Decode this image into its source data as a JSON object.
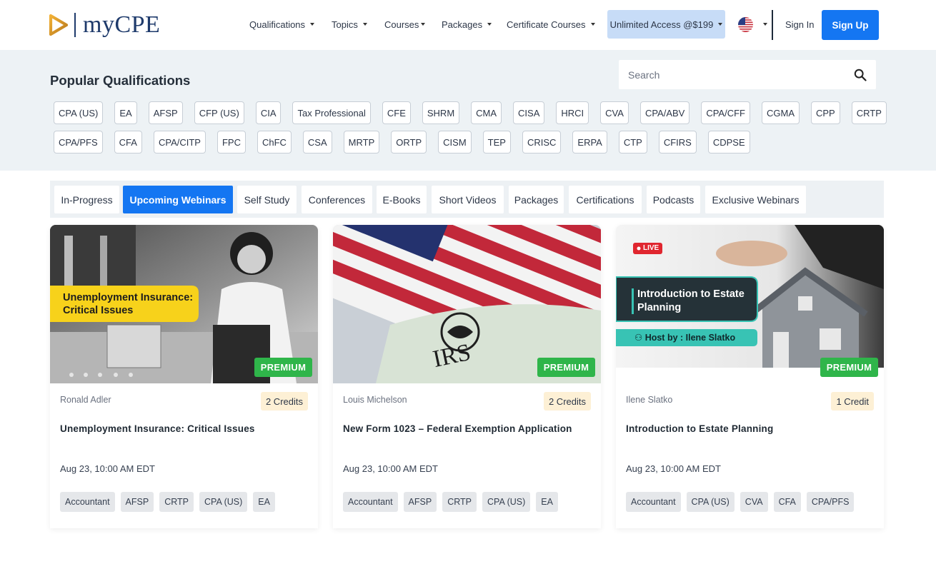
{
  "brand": {
    "name": "myCPE",
    "accent": "#1476f2",
    "navy": "#1e3a6b",
    "gold": "#d99a2b"
  },
  "nav": {
    "items": [
      {
        "label": "Qualifications"
      },
      {
        "label": "Topics"
      },
      {
        "label": "Courses"
      },
      {
        "label": "Packages"
      },
      {
        "label": "Certificate Courses"
      }
    ],
    "unlimited": "Unlimited Access @$199",
    "flag_icon": "us-flag-icon",
    "sign_in": "Sign In",
    "sign_up": "Sign Up"
  },
  "qualifications": {
    "title": "Popular Qualifications",
    "search_placeholder": "Search",
    "row1": [
      "CPA (US)",
      "EA",
      "AFSP",
      "CFP (US)",
      "CIA",
      "Tax Professional",
      "CFE",
      "SHRM",
      "CMA",
      "CISA",
      "HRCI",
      "CVA",
      "CPA/ABV",
      "CPA/CFF",
      "CGMA",
      "CPP",
      "CRTP"
    ],
    "row2": [
      "CPA/PFS",
      "CFA",
      "CPA/CITP",
      "FPC",
      "ChFC",
      "CSA",
      "MRTP",
      "ORTP",
      "CISM",
      "TEP",
      "CRISC",
      "ERPA",
      "CTP",
      "CFIRS",
      "CDPSE"
    ]
  },
  "tabs": [
    {
      "label": "In-Progress"
    },
    {
      "label": "Upcoming Webinars",
      "active": true
    },
    {
      "label": "Self Study"
    },
    {
      "label": "Conferences"
    },
    {
      "label": "E-Books"
    },
    {
      "label": "Short Videos"
    },
    {
      "label": "Packages"
    },
    {
      "label": "Certifications"
    },
    {
      "label": "Podcasts"
    },
    {
      "label": "Exclusive Webinars"
    }
  ],
  "cards": [
    {
      "image_text": "Unemployment Insurance: Critical Issues",
      "badge": "PREMIUM",
      "author": "Ronald Adler",
      "credits": "2 Credits",
      "title": "Unemployment Insurance: Critical Issues",
      "date": "Aug 23, 10:00 AM EDT",
      "tags": [
        "Accountant",
        "AFSP",
        "CRTP",
        "CPA (US)",
        "EA"
      ]
    },
    {
      "image_text": "IRS",
      "badge": "PREMIUM",
      "author": "Louis Michelson",
      "credits": "2 Credits",
      "title": "New Form 1023 – Federal Exemption Application",
      "date": "Aug 23, 10:00 AM EDT",
      "tags": [
        "Accountant",
        "AFSP",
        "CRTP",
        "CPA (US)",
        "EA"
      ]
    },
    {
      "image_text": "Introduction to Estate Planning",
      "image_host": "Host by : Ilene Slatko",
      "image_live": "LIVE",
      "badge": "PREMIUM",
      "author": "Ilene Slatko",
      "credits": "1 Credit",
      "title": "Introduction to Estate Planning",
      "date": "Aug 23, 10:00 AM EDT",
      "tags": [
        "Accountant",
        "CPA (US)",
        "CVA",
        "CFA",
        "CPA/PFS"
      ]
    }
  ]
}
